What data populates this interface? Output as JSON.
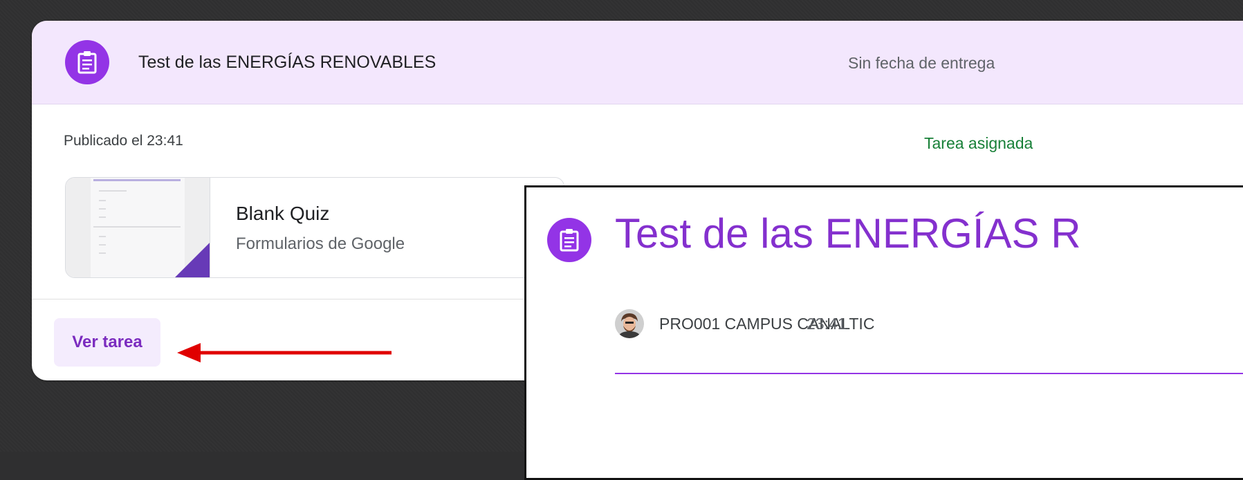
{
  "card": {
    "title": "Test de las ENERGÍAS RENOVABLES",
    "due": "Sin fecha de entrega",
    "published": "Publicado el 23:41",
    "status": "Tarea asignada",
    "attachment": {
      "title": "Blank Quiz",
      "subtitle": "Formularios de Google"
    },
    "view_button": "Ver tarea"
  },
  "detail": {
    "title": "Test de las ENERGÍAS R",
    "author": "PRO001 CAMPUS CANALTIC",
    "time": "23:41"
  },
  "colors": {
    "accent": "#9334e6",
    "header_bg": "#f3e7fd",
    "status_green": "#188038",
    "arrow_red": "#e00000"
  },
  "icons": {
    "assignment": "assignment-icon",
    "avatar": "avatar",
    "annotation_arrow": "arrow-left-icon"
  }
}
